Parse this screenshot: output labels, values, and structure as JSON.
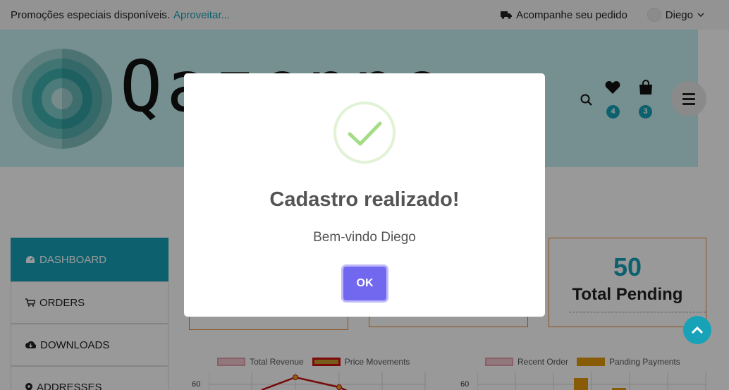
{
  "topbar": {
    "promo_text": "Promoções especiais disponíveis.",
    "promo_link": "Aproveitar...",
    "track_label": "Acompanhe seu pedido",
    "user_name": "Diego"
  },
  "header": {
    "logo_text": "Qazenne",
    "wishlist_count": "4",
    "cart_count": "3"
  },
  "sidebar": {
    "items": [
      {
        "label": "DASHBOARD",
        "icon": "dashboard-icon",
        "active": true
      },
      {
        "label": "ORDERS",
        "icon": "cart-icon",
        "active": false
      },
      {
        "label": "DOWNLOADS",
        "icon": "cloud-download-icon",
        "active": false
      },
      {
        "label": "ADDRESSES",
        "icon": "map-pin-icon",
        "active": false
      }
    ]
  },
  "stats": {
    "pending_value": "50",
    "pending_label": "Total Pending"
  },
  "charts": [
    {
      "type": "line",
      "legend": [
        "Total Revenue",
        "Price Movements"
      ],
      "y_tick_top": "60"
    },
    {
      "type": "bar",
      "legend": [
        "Recent Order",
        "Panding Payments"
      ],
      "y_tick_top": "60"
    }
  ],
  "modal": {
    "title": "Cadastro realizado!",
    "message": "Bem-vindo Diego",
    "ok_label": "OK"
  },
  "colors": {
    "accent": "#17a2b8",
    "orange": "#e8872f",
    "ok_button": "#7267ef",
    "success": "#a5dc86"
  }
}
